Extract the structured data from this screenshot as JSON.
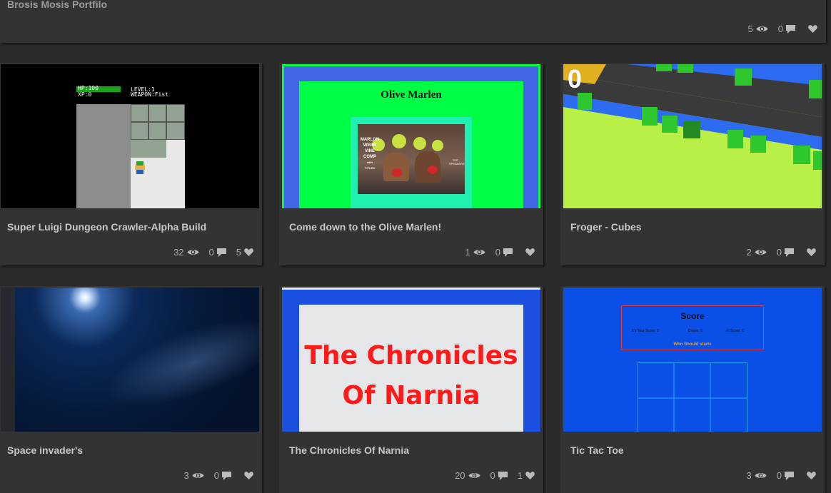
{
  "top": {
    "title": "Brosis Mosis Portfilo",
    "views": "5",
    "comments": "0",
    "likes": ""
  },
  "cards": [
    {
      "title": "Super Luigi Dungeon Crawler-Alpha Build",
      "views": "32",
      "comments": "0",
      "likes": "5",
      "thumb": {
        "hp": "HP:100",
        "xp": "XP:0",
        "level": "LEVEL:1",
        "weapon": "WEAPON:Fist"
      }
    },
    {
      "title": "Come down to the Olive Marlen!",
      "views": "1",
      "comments": "0",
      "likes": "",
      "thumb": {
        "heading": "Olive Marlen",
        "lines": [
          "MARLON",
          "WEBB",
          "VINE",
          "COMP",
          "with",
          "TITLES"
        ],
        "side": "TOP SPEAKERS"
      }
    },
    {
      "title": "Froger - Cubes",
      "views": "2",
      "comments": "0",
      "likes": "",
      "thumb": {
        "score": "0"
      }
    },
    {
      "title": "Space invader's",
      "views": "3",
      "comments": "0",
      "likes": "",
      "thumb": {}
    },
    {
      "title": "The Chronicles Of Narnia",
      "views": "20",
      "comments": "0",
      "likes": "1",
      "thumb": {
        "line1": "The Chronicles",
        "line2": "Of Narnia"
      }
    },
    {
      "title": "Tic Tac Toe",
      "views": "3",
      "comments": "0",
      "likes": "",
      "thumb": {
        "score_title": "Score",
        "your": "It's Your Score: 0",
        "draws": "Draws: 0",
        "ai": "AI Score: 0",
        "who": "Who Should starts"
      }
    }
  ],
  "colors": {
    "card": "#333333",
    "bg": "#2b2b2b",
    "text": "#c8c8c8",
    "green": "#00ff44",
    "blue": "#1a4fe0"
  }
}
